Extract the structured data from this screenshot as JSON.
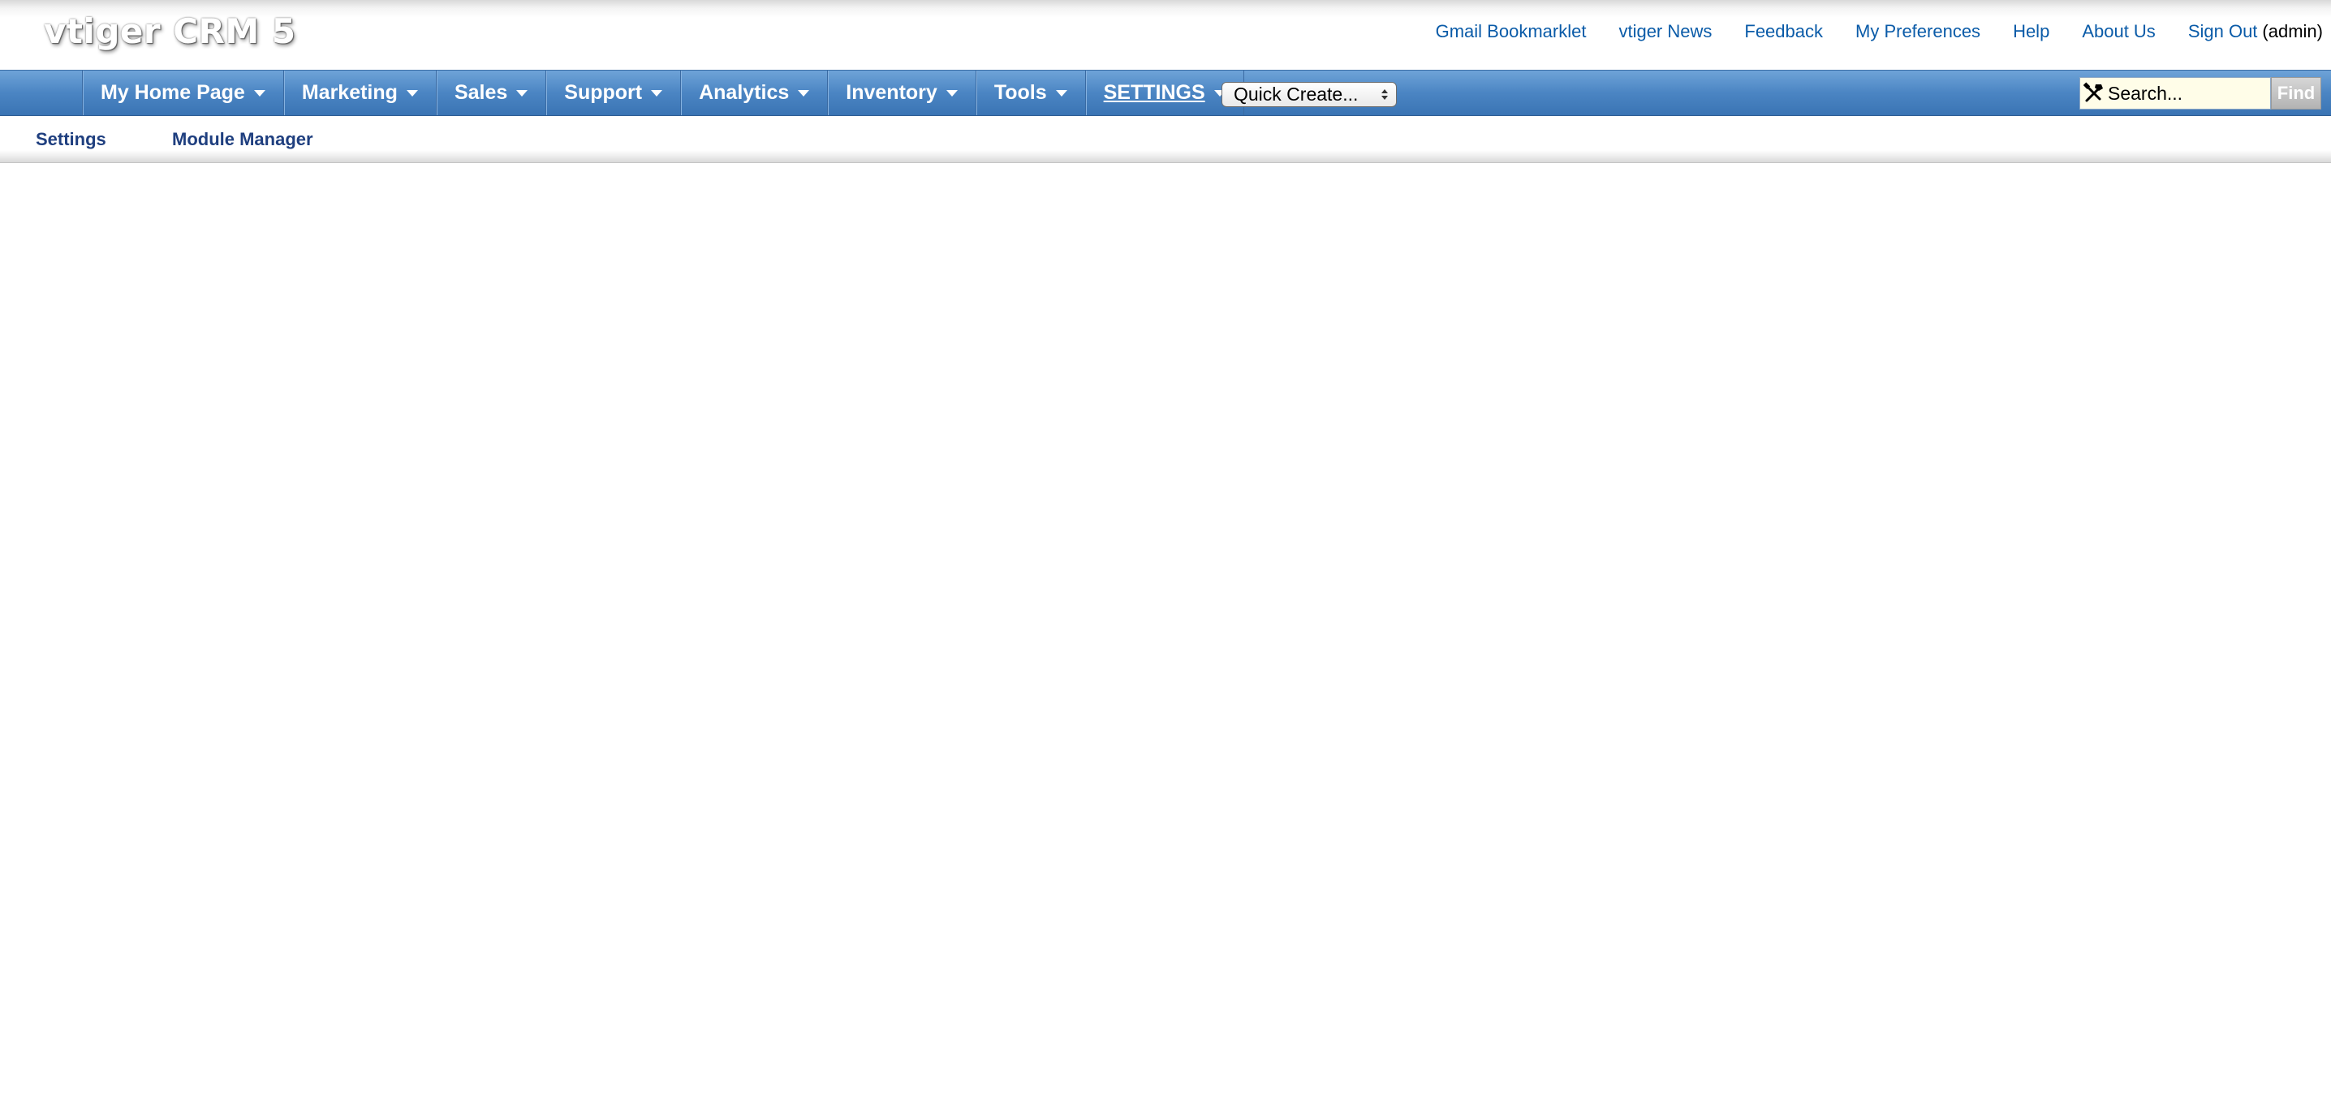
{
  "app": {
    "logo": "vtiger CRM 5"
  },
  "top_links": [
    {
      "label": "Gmail Bookmarklet"
    },
    {
      "label": "vtiger News"
    },
    {
      "label": "Feedback"
    },
    {
      "label": "My Preferences"
    },
    {
      "label": "Help"
    },
    {
      "label": "About Us"
    },
    {
      "label": "Sign Out"
    }
  ],
  "user": {
    "label": "(admin)"
  },
  "nav": {
    "items": [
      {
        "label": "My Home Page"
      },
      {
        "label": "Marketing"
      },
      {
        "label": "Sales"
      },
      {
        "label": "Support"
      },
      {
        "label": "Analytics"
      },
      {
        "label": "Inventory"
      },
      {
        "label": "Tools"
      },
      {
        "label": "SETTINGS",
        "active": true
      }
    ],
    "quick_create": "Quick Create..."
  },
  "search": {
    "placeholder": "Search...",
    "find_label": "Find"
  },
  "subnav": {
    "items": [
      {
        "label": "Settings"
      },
      {
        "label": "Module Manager"
      }
    ]
  },
  "colors": {
    "nav_blue": "#4b85c3",
    "link_blue": "#0a5ba8",
    "subnav_link": "#1f3f7f",
    "search_bg": "#fffde8"
  }
}
